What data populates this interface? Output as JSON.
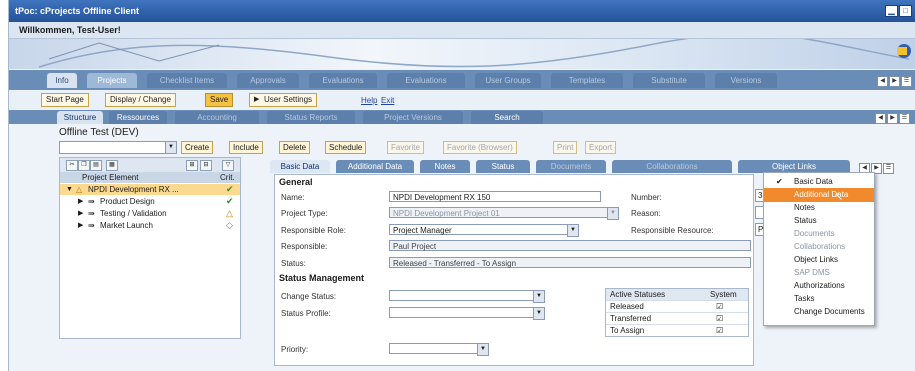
{
  "window": {
    "title": "tPoc: cProjects Offline Client"
  },
  "welcome": "Willkommen, Test-User!",
  "main_tabs": [
    "Info",
    "Projects",
    "Checklist Items",
    "Approvals",
    "Evaluations",
    "Evaluations",
    "User Groups",
    "Templates",
    "Substitute",
    "Versions"
  ],
  "toolbar": {
    "start_page": "Start Page",
    "display_change": "Display / Change",
    "save": "Save",
    "user_settings": "User Settings",
    "help": "Help",
    "exit": "Exit"
  },
  "sub_tabs": [
    "Structure",
    "Ressources",
    "Accounting",
    "Status Reports",
    "Project Versions",
    "Search"
  ],
  "project_title": "Offline Test (DEV)",
  "actions": {
    "create": "Create",
    "include": "Include",
    "delete": "Delete",
    "schedule": "Schedule",
    "favorite": "Favorite",
    "favorite_browser": "Favorite (Browser)",
    "print": "Print",
    "export": "Export"
  },
  "tree": {
    "header_element": "Project Element",
    "header_crit": "Crit.",
    "rows": [
      {
        "label": "NPDI Development RX ...",
        "crit": "✔"
      },
      {
        "label": "Product Design",
        "crit": "✔"
      },
      {
        "label": "Testing / Validation",
        "crit": "△"
      },
      {
        "label": "Market Launch",
        "crit": "◇"
      }
    ]
  },
  "detail_tabs": [
    "Basic Data",
    "Additional Data",
    "Notes",
    "Status",
    "Documents",
    "Collaborations",
    "Object Links"
  ],
  "form": {
    "general": "General",
    "name_label": "Name:",
    "name_value": "NPDI Development RX 150",
    "number_label": "Number:",
    "number_value": "330",
    "type_label": "Project Type:",
    "type_value": "NPDI Development Project 01",
    "reason_label": "Reason:",
    "role_label": "Responsible Role:",
    "role_value": "Project Manager",
    "resource_label": "Responsible Resource:",
    "resource_value": "Pa",
    "responsible_label": "Responsible:",
    "responsible_value": "Paul Project",
    "status_label": "Status:",
    "status_value": "Released - Transferred - To Assign",
    "status_mgmt": "Status Management",
    "change_status_label": "Change Status:",
    "status_profile_label": "Status Profile:",
    "priority_label": "Priority:"
  },
  "active_statuses": {
    "h1": "Active Statuses",
    "h2": "System",
    "rows": [
      {
        "name": "Released",
        "check": "☑"
      },
      {
        "name": "Transferred",
        "check": "☑"
      },
      {
        "name": "To Assign",
        "check": "☑"
      }
    ]
  },
  "dropdown_menu": [
    {
      "label": "Basic Data",
      "checked": "✔"
    },
    {
      "label": "Additional Data",
      "checked": ""
    },
    {
      "label": "Notes",
      "checked": ""
    },
    {
      "label": "Status",
      "checked": ""
    },
    {
      "label": "Documents",
      "checked": ""
    },
    {
      "label": "Collaborations",
      "checked": ""
    },
    {
      "label": "Object Links",
      "checked": ""
    },
    {
      "label": "SAP DMS",
      "checked": ""
    },
    {
      "label": "Authorizations",
      "checked": ""
    },
    {
      "label": "Tasks",
      "checked": ""
    },
    {
      "label": "Change Documents",
      "checked": ""
    }
  ]
}
